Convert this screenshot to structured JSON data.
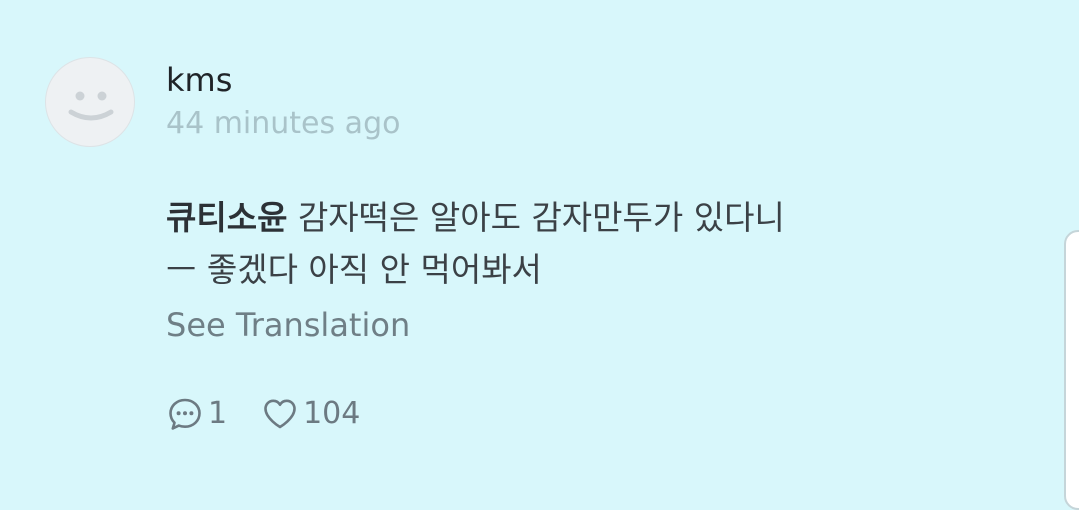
{
  "comment": {
    "username": "kms",
    "timestamp": "44 minutes ago",
    "mention": "큐티소윤",
    "text_line1": " 감자떡은 알아도 감자만두가 있다니",
    "text_line2": "ㅡ 좋겠다 아직 안 먹어봐서",
    "see_translation": "See Translation",
    "reply_count": "1",
    "like_count": "104",
    "avatar_icon": "smiley-face-icon",
    "reply_icon": "speech-bubble-icon",
    "like_icon": "heart-outline-icon"
  },
  "colors": {
    "background": "#d8f7fb",
    "username": "#1f2428",
    "timestamp": "#a9c3c9",
    "body": "#3b4146",
    "secondary": "#6f7f86"
  }
}
